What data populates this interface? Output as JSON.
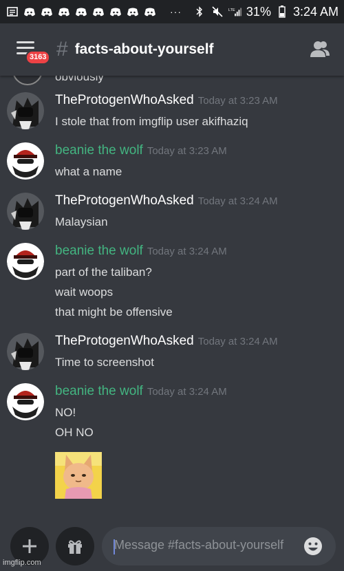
{
  "status_bar": {
    "dots": "···",
    "battery": "31%",
    "time": "3:24 AM",
    "network": "LTE"
  },
  "header": {
    "badge": "3163",
    "hash": "#",
    "channel_name": "facts-about-yourself"
  },
  "cut_message": "obviously",
  "messages": [
    {
      "author": "TheProtogenWhoAsked",
      "timestamp": "Today at 3:23 AM",
      "lines": [
        "I stole that from imgflip user akifhaziq"
      ]
    },
    {
      "author": "beanie the wolf",
      "timestamp": "Today at 3:23 AM",
      "lines": [
        "what a name"
      ]
    },
    {
      "author": "TheProtogenWhoAsked",
      "timestamp": "Today at 3:24 AM",
      "lines": [
        "Malaysian"
      ]
    },
    {
      "author": "beanie the wolf",
      "timestamp": "Today at 3:24 AM",
      "lines": [
        "part of the taliban?",
        "wait woops",
        "that might be offensive"
      ]
    },
    {
      "author": "TheProtogenWhoAsked",
      "timestamp": "Today at 3:24 AM",
      "lines": [
        "Time to screenshot"
      ]
    },
    {
      "author": "beanie the wolf",
      "timestamp": "Today at 3:24 AM",
      "lines": [
        "NO!",
        "OH NO"
      ],
      "attachment": "cat-sticker-image"
    }
  ],
  "composer": {
    "placeholder": "Message #facts-about-yourself"
  },
  "watermark": "imgflip.com",
  "colors": {
    "background": "#36393f",
    "beanie_name": "#43b581",
    "protogen_name": "#ffffff",
    "timestamp": "#72767d",
    "badge": "#ed4245"
  }
}
